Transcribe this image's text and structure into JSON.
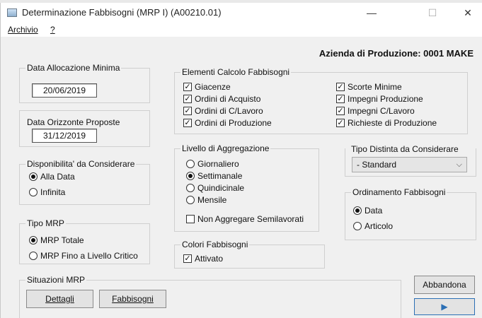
{
  "window": {
    "title": "Determinazione Fabbisogni (MRP I)  (A00210.01)",
    "minimize": "—",
    "maximize": "☐",
    "close": "✕"
  },
  "menu": {
    "archivio": "Archivio",
    "help": "?"
  },
  "company": "Azienda di Produzione: 0001 MAKE",
  "data_allocazione": {
    "label": "Data Allocazione Minima",
    "value": "20/06/2019"
  },
  "data_orizzonte": {
    "label": "Data Orizzonte Proposte",
    "value": "31/12/2019"
  },
  "disponibilita": {
    "label": "Disponibilita' da Considerare",
    "options": [
      "Alla Data",
      "Infinita"
    ],
    "selected": "Alla Data"
  },
  "tipo_mrp": {
    "label": "Tipo MRP",
    "options": [
      "MRP Totale",
      "MRP Fino a Livello Critico"
    ],
    "selected": "MRP Totale"
  },
  "situazioni": {
    "label": "Situazioni MRP",
    "dettagli": "Dettagli",
    "fabbisogni": "Fabbisogni"
  },
  "elementi": {
    "label": "Elementi Calcolo Fabbisogni",
    "left": [
      "Giacenze",
      "Ordini di Acquisto",
      "Ordini di C/Lavoro",
      "Ordini di Produzione"
    ],
    "right": [
      "Scorte Minime",
      "Impegni Produzione",
      "Impegni C/Lavoro",
      "Richieste di Produzione"
    ]
  },
  "livello": {
    "label": "Livello di Aggregazione",
    "options": [
      "Giornaliero",
      "Settimanale",
      "Quindicinale",
      "Mensile"
    ],
    "selected": "Settimanale",
    "non_aggregare": "Non Aggregare Semilavorati"
  },
  "colori": {
    "label": "Colori Fabbisogni",
    "attivato": "Attivato"
  },
  "tipo_distinta": {
    "label": "Tipo Distinta da Considerare",
    "value": "- Standard"
  },
  "ordinamento": {
    "label": "Ordinamento Fabbisogni",
    "options": [
      "Data",
      "Articolo"
    ],
    "selected": "Data"
  },
  "buttons": {
    "abbandona": "Abbandona",
    "run": "▶"
  }
}
